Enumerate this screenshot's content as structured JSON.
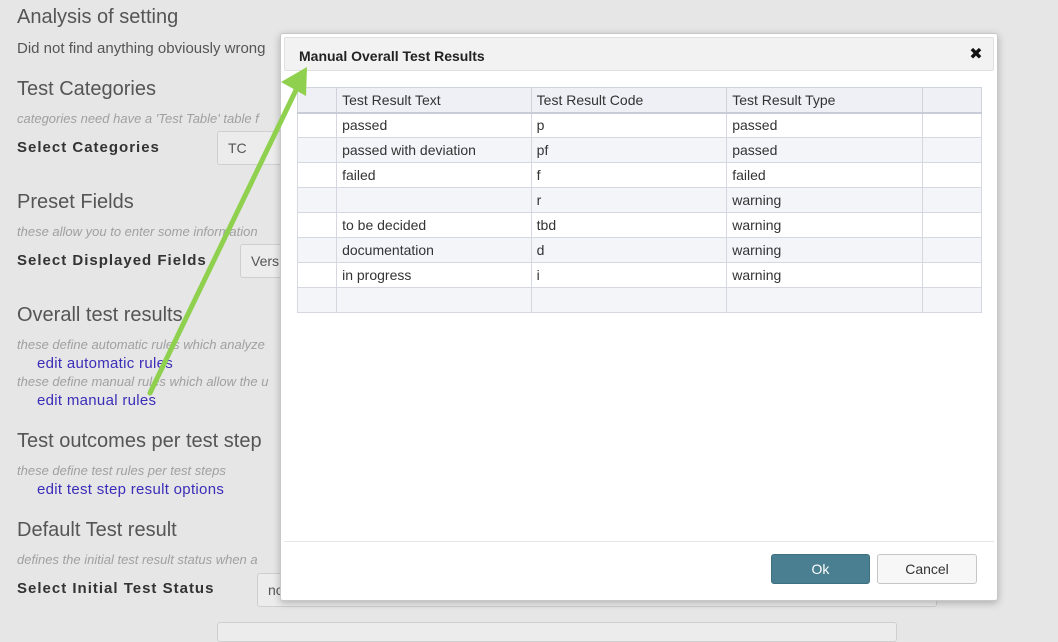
{
  "background": {
    "heading_analysis": "Analysis of setting",
    "analysis_text": "Did not find anything obviously wrong",
    "heading_categories": "Test Categories",
    "categories_note": "categories need have a 'Test Table' table f",
    "select_categories_label": "Select Categories",
    "select_categories_value": "TC",
    "heading_preset": "Preset Fields",
    "preset_note": "these allow you to enter some information",
    "select_displayed_label": "Select Displayed Fields",
    "select_displayed_value": "Vers",
    "heading_overall": "Overall test results",
    "overall_note_auto": "these define automatic rules which analyze",
    "link_auto": "edit automatic rules",
    "overall_note_manual": "these define manual rules which allow the u",
    "link_manual": "edit manual rules",
    "heading_outcomes": "Test outcomes per test step",
    "outcomes_note": "these define test rules per test steps",
    "link_step": "edit test step result options",
    "heading_default": "Default Test result",
    "default_note": "defines the initial test result status when a",
    "select_initial_label": "Select Initial Test Status",
    "select_initial_value": "no"
  },
  "modal": {
    "title": "Manual Overall Test Results",
    "close_glyph": "✖",
    "columns": [
      "",
      "Test Result Text",
      "Test Result Code",
      "Test Result Type",
      ""
    ],
    "rows": [
      {
        "text": "passed",
        "code": "p",
        "type": "passed"
      },
      {
        "text": "passed with deviation",
        "code": "pf",
        "type": "passed"
      },
      {
        "text": "failed",
        "code": "f",
        "type": "failed"
      },
      {
        "text": "",
        "code": "r",
        "type": "warning"
      },
      {
        "text": "to be decided",
        "code": "tbd",
        "type": "warning"
      },
      {
        "text": "documentation",
        "code": "d",
        "type": "warning"
      },
      {
        "text": "in progress",
        "code": "i",
        "type": "warning"
      },
      {
        "text": "",
        "code": "",
        "type": ""
      }
    ],
    "ok_label": "Ok",
    "cancel_label": "Cancel"
  },
  "colors": {
    "link": "#3a2db8",
    "ok_button": "#4a7f91",
    "arrow": "#8fd14f"
  },
  "annotation": {
    "icon": "green-arrow-icon"
  }
}
